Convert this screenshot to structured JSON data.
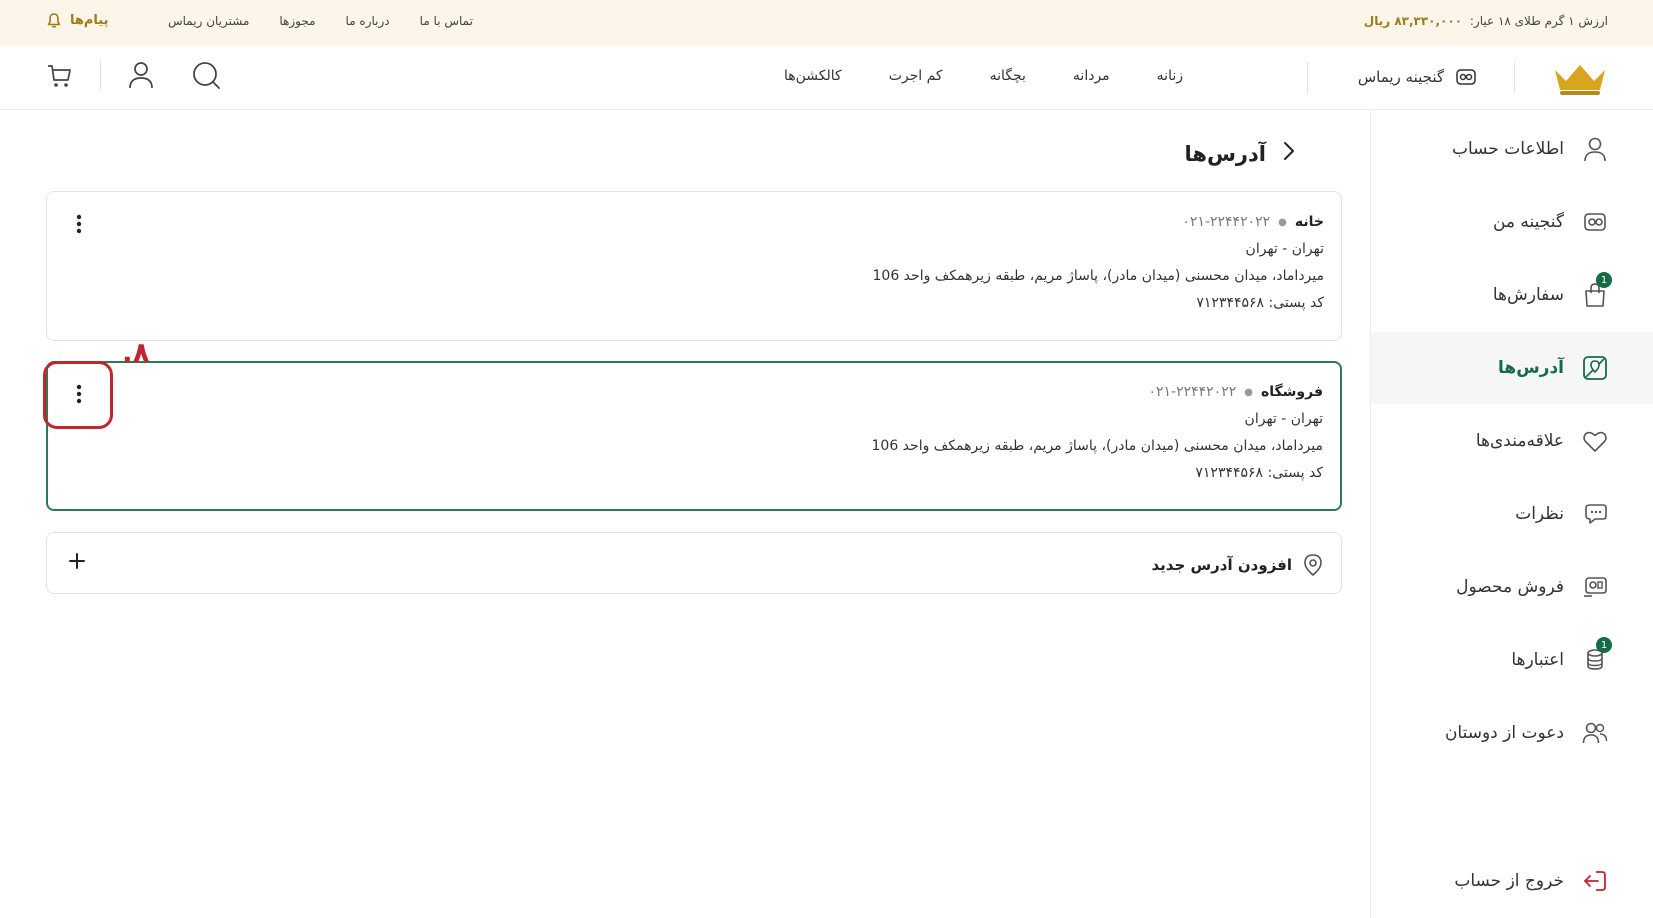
{
  "top_bar": {
    "price_label": "ارزش ۱ گرم طلای ۱۸ عیار:",
    "price_value": "۸۳,۳۳۰,۰۰۰ ریال",
    "links": [
      "مشتریان ریماس",
      "مجوزها",
      "درباره ما",
      "تماس با ما"
    ],
    "messages_label": "پیام‌ها"
  },
  "header": {
    "brand_label": "گنجینه ریماس",
    "nav": [
      "زنانه",
      "مردانه",
      "بچگانه",
      "کم اجرت",
      "کالکشن‌ها"
    ]
  },
  "sidebar": {
    "items": [
      {
        "label": "اطلاعات حساب",
        "icon": "user-icon"
      },
      {
        "label": "گنجینه من",
        "icon": "treasure-icon"
      },
      {
        "label": "سفارش‌ها",
        "icon": "bag-icon",
        "badge": "1"
      },
      {
        "label": "آدرس‌ها",
        "icon": "map-icon",
        "active": true
      },
      {
        "label": "علاقه‌مندی‌ها",
        "icon": "heart-icon"
      },
      {
        "label": "نظرات",
        "icon": "comments-icon"
      },
      {
        "label": "فروش محصول",
        "icon": "sell-icon"
      },
      {
        "label": "اعتبارها",
        "icon": "coins-icon",
        "badge": "1"
      },
      {
        "label": "دعوت از دوستان",
        "icon": "users-icon"
      }
    ],
    "logout_label": "خروج از حساب"
  },
  "main": {
    "title": "آدرس‌ها",
    "addresses": [
      {
        "name": "خانه",
        "phone": "۰۲۱-۲۲۴۴۲۰۲۲",
        "city": "تهران - تهران",
        "street": "میرداماد، میدان محسنی (میدان مادر)، پاساژ مریم، طبقه زیرهمکف واحد 106",
        "postal": "کد پستی: ۷۱۲۳۴۴۵۶۸"
      },
      {
        "name": "فروشگاه",
        "phone": "۰۲۱-۲۲۴۴۲۰۲۲",
        "city": "تهران - تهران",
        "street": "میرداماد، میدان محسنی (میدان مادر)، پاساژ مریم، طبقه زیرهمکف واحد 106",
        "postal": "کد پستی: ۷۱۲۳۴۴۵۶۸"
      }
    ],
    "add_label": "افزودن آدرس جدید",
    "annotation": "۸."
  },
  "colors": {
    "gold": "#a07a15",
    "green": "#146b45",
    "highlight": "#c0262d"
  }
}
